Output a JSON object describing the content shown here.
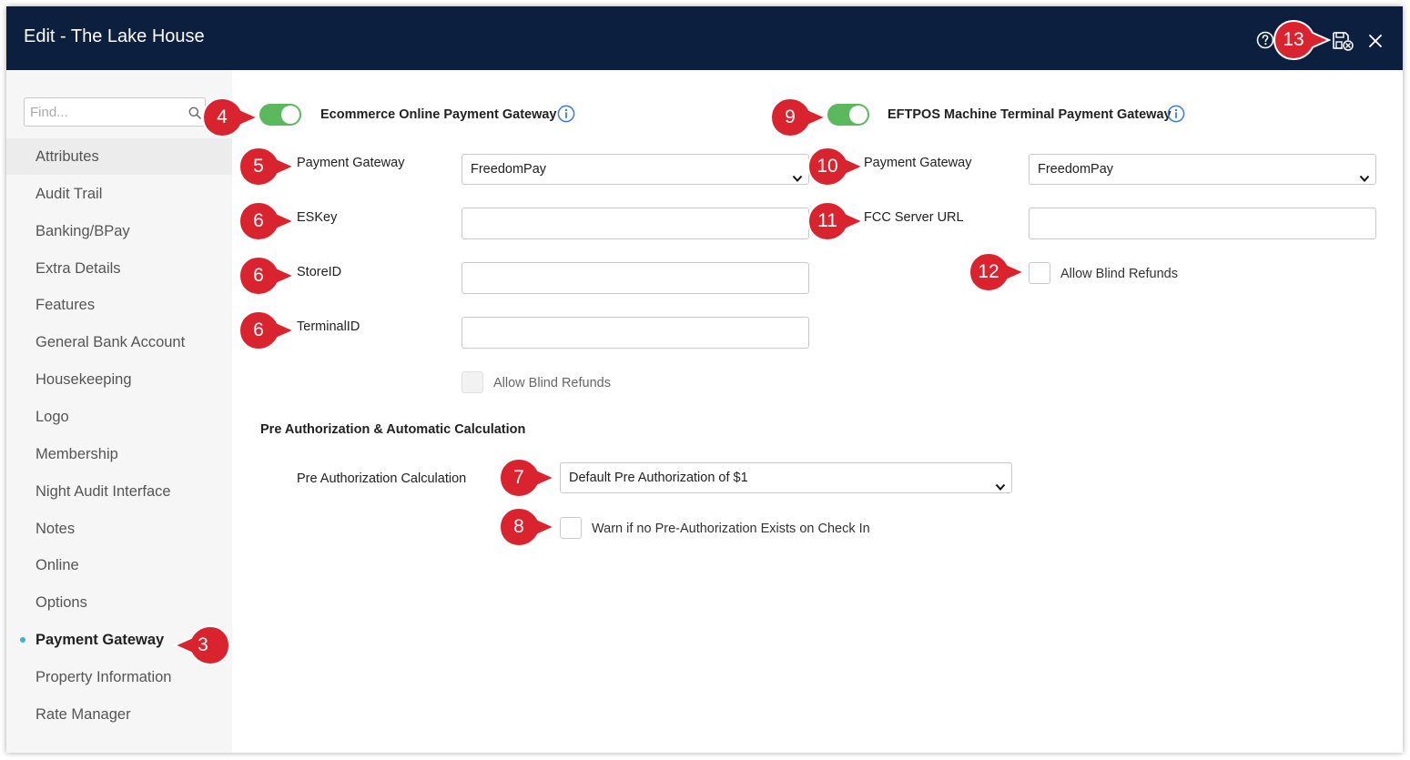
{
  "window": {
    "title": "Edit - The Lake House"
  },
  "titlebar": {
    "icons": [
      "help-icon",
      "save-close-icon",
      "close-icon"
    ]
  },
  "sidebar": {
    "find_placeholder": "Find...",
    "items": [
      {
        "label": "Attributes"
      },
      {
        "label": "Audit Trail"
      },
      {
        "label": "Banking/BPay"
      },
      {
        "label": "Extra Details"
      },
      {
        "label": "Features"
      },
      {
        "label": "General Bank Account"
      },
      {
        "label": "Housekeeping"
      },
      {
        "label": "Logo"
      },
      {
        "label": "Membership"
      },
      {
        "label": "Night Audit Interface"
      },
      {
        "label": "Notes"
      },
      {
        "label": "Online"
      },
      {
        "label": "Options"
      },
      {
        "label": "Payment Gateway"
      },
      {
        "label": "Property Information"
      },
      {
        "label": "Rate Manager"
      }
    ],
    "active_item": "Payment Gateway",
    "active_dot_color": "#3ab5c8"
  },
  "ecommerce": {
    "title": "Ecommerce Online Payment Gateway",
    "enabled": true,
    "gateway_label": "Payment Gateway",
    "gateway_value": "FreedomPay",
    "eskey_label": "ESKey",
    "eskey_value": "",
    "storeid_label": "StoreID",
    "storeid_value": "",
    "terminalid_label": "TerminalID",
    "terminalid_value": "",
    "blind_refunds_label": "Allow Blind Refunds",
    "blind_refunds_checked": false
  },
  "eftpos": {
    "title": "EFTPOS Machine Terminal Payment Gateway",
    "enabled": true,
    "gateway_label": "Payment Gateway",
    "gateway_value": "FreedomPay",
    "fcc_label": "FCC Server URL",
    "fcc_value": "",
    "blind_refunds_label": "Allow Blind Refunds",
    "blind_refunds_checked": false
  },
  "preauth": {
    "heading": "Pre Authorization & Automatic Calculation",
    "calc_label": "Pre Authorization Calculation",
    "calc_value": "Default Pre Authorization of $1",
    "warn_label": "Warn if no Pre-Authorization Exists on Check In",
    "warn_checked": false
  },
  "markers": {
    "sidebar_payment_gateway": "3",
    "ecommerce_toggle": "4",
    "ecommerce_gateway": "5",
    "eskey": "6",
    "storeid": "6",
    "terminalid": "6",
    "preauth_calc": "7",
    "preauth_warn": "8",
    "eftpos_toggle": "9",
    "eftpos_gateway": "10",
    "fcc_url": "11",
    "eftpos_blind_refunds": "12",
    "save_close": "13"
  },
  "colors": {
    "titlebar": "#0c1f3f",
    "toggle_on": "#5cb85c",
    "marker": "#d9232e",
    "info_icon": "#3b7dd8",
    "sidebar_bg": "#f6f6f6"
  }
}
